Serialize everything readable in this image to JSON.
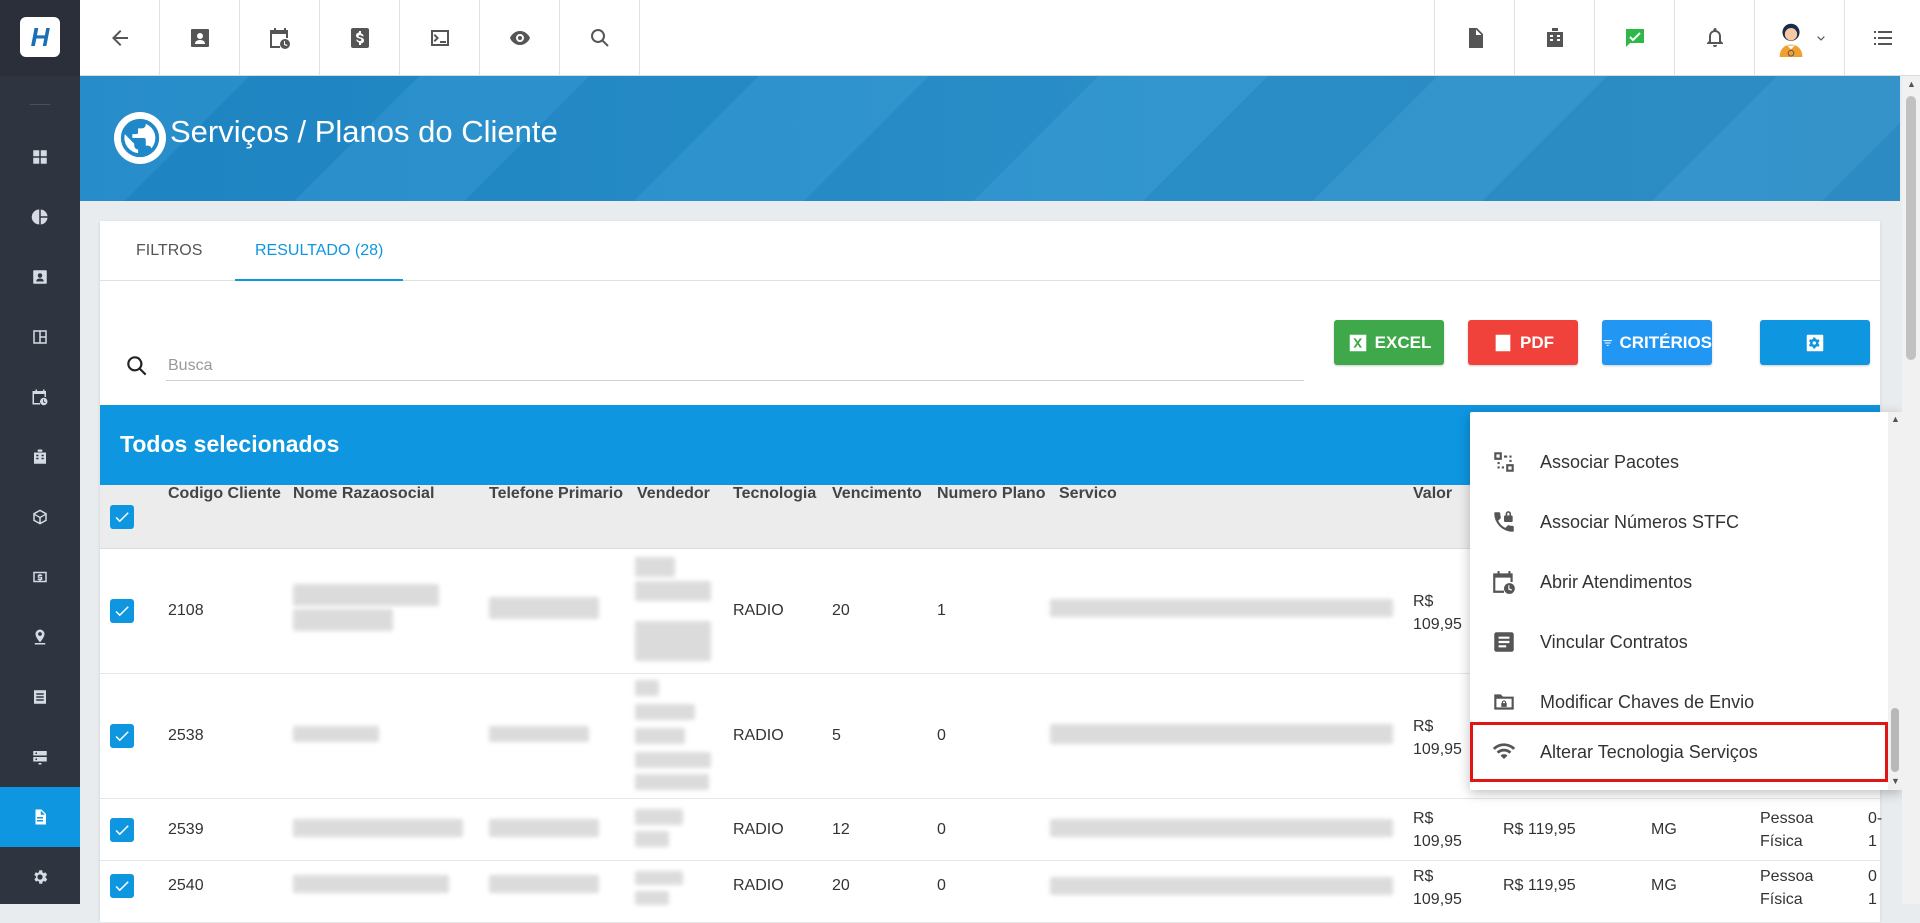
{
  "sidebar": {
    "logo_text": "H",
    "items": [
      {
        "icon": "dashboard-icon"
      },
      {
        "icon": "pie-chart-icon"
      },
      {
        "icon": "contact-card-icon"
      },
      {
        "icon": "board-icon"
      },
      {
        "icon": "calendar-clock-icon"
      },
      {
        "icon": "building-icon"
      },
      {
        "icon": "package-icon"
      },
      {
        "icon": "money-icon"
      },
      {
        "icon": "map-pin-icon"
      },
      {
        "icon": "list-icon"
      },
      {
        "icon": "server-icon"
      },
      {
        "icon": "document-icon",
        "active": true
      },
      {
        "icon": "settings-icon"
      }
    ]
  },
  "topbar": {
    "left_icons": [
      "back-arrow-icon",
      "contact-card-icon",
      "calendar-clock-icon",
      "dollar-icon",
      "terminal-icon",
      "eye-icon",
      "search-icon"
    ],
    "right_icons": [
      "pdf-icon",
      "building-icon",
      "chat-check-icon",
      "bell-icon",
      "avatar",
      "chevron-down-icon",
      "menu-list-icon"
    ]
  },
  "header": {
    "title": "Serviços / Planos do Cliente"
  },
  "tabs": [
    {
      "label": "FILTROS",
      "active": false
    },
    {
      "label": "RESULTADO (28)",
      "active": true
    }
  ],
  "search": {
    "placeholder": "Busca",
    "value": ""
  },
  "buttons": {
    "excel": "EXCEL",
    "pdf": "PDF",
    "criterios": "CRITÉRIOS"
  },
  "selection_bar": {
    "text": "Todos selecionados"
  },
  "table": {
    "columns": [
      "Codigo Cliente",
      "Nome Razaosocial",
      "Telefone Primario",
      "Vendedor",
      "Tecnologia",
      "Vencimento",
      "Numero Plano",
      "Servico",
      "Valor"
    ],
    "rows": [
      {
        "codigo": "2108",
        "tecnologia": "RADIO",
        "vencimento": "20",
        "numero_plano": "1",
        "valor_line1": "R$",
        "valor_line2": "109,95",
        "valor2": "",
        "uf": "",
        "tipo_line1": "",
        "tipo_line2": "",
        "extra": ""
      },
      {
        "codigo": "2538",
        "tecnologia": "RADIO",
        "vencimento": "5",
        "numero_plano": "0",
        "valor_line1": "R$",
        "valor_line2": "109,95",
        "valor2": "",
        "uf": "",
        "tipo_line1": "",
        "tipo_line2": "",
        "extra": ""
      },
      {
        "codigo": "2539",
        "tecnologia": "RADIO",
        "vencimento": "12",
        "numero_plano": "0",
        "valor_line1": "R$",
        "valor_line2": "109,95",
        "valor2": "R$ 119,95",
        "uf": "MG",
        "tipo_line1": "Pessoa",
        "tipo_line2": "Física",
        "extra_line1": "0-",
        "extra_line2": "1"
      },
      {
        "codigo": "2540",
        "tecnologia": "RADIO",
        "vencimento": "20",
        "numero_plano": "0",
        "valor_line1": "R$",
        "valor_line2": "109,95",
        "valor2": "R$ 119,95",
        "uf": "MG",
        "tipo_line1": "Pessoa",
        "tipo_line2": "Física",
        "extra_line1": "0",
        "extra_line2": "1"
      }
    ]
  },
  "dropdown": {
    "items": [
      {
        "label": "Associar Pacotes",
        "icon": "package-link-icon"
      },
      {
        "label": "Associar Números STFC",
        "icon": "phone-lock-icon"
      },
      {
        "label": "Abrir Atendimentos",
        "icon": "calendar-clock-icon"
      },
      {
        "label": "Vincular Contratos",
        "icon": "contract-icon"
      },
      {
        "label": "Modificar Chaves de Envio",
        "icon": "folder-lock-icon"
      },
      {
        "label": "Alterar Tecnologia Serviços",
        "icon": "wifi-icon",
        "highlighted": true
      }
    ]
  },
  "colors": {
    "primary": "#0e96e0",
    "excel": "#3ea84a",
    "pdf": "#f0413a",
    "criterios": "#2196f3",
    "settings": "#0e96e0",
    "sidebar": "#2e3440",
    "highlight_border": "#e01515"
  }
}
